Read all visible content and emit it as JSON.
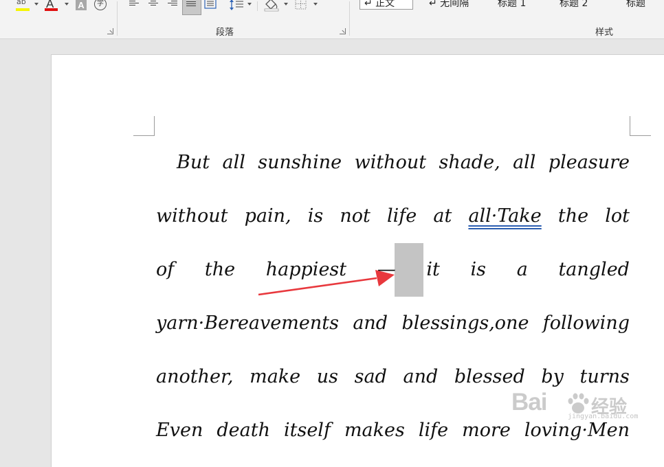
{
  "ribbon": {
    "font_group": {
      "highlight_glyph": "ab",
      "font_color_glyph": "A",
      "char_shading_glyph": "A",
      "enclose_char_glyph": "字"
    },
    "paragraph_group": {
      "label": "段落"
    },
    "styles_group": {
      "label": "样式",
      "items": [
        {
          "label": "↵ 正文",
          "selected": true
        },
        {
          "label": "↵ 无间隔",
          "selected": false
        },
        {
          "label": "标题 1",
          "selected": false
        },
        {
          "label": "标题 2",
          "selected": false
        },
        {
          "label": "标题",
          "selected": false
        }
      ]
    },
    "colors": {
      "highlight": "#f5f500",
      "font_color": "#e01010"
    }
  },
  "document": {
    "lines": [
      [
        "But",
        "all",
        "sunshine",
        "without",
        "shade,",
        "all",
        "pleasure"
      ],
      [
        "without",
        "pain,",
        "is",
        "not",
        "life",
        "at",
        "all·Take",
        "the",
        "lot"
      ],
      [
        "of",
        "the",
        "happiest",
        "—",
        "it",
        "is",
        "a",
        "tangled"
      ],
      [
        "yarn·Bereavements",
        "and",
        "blessings,one",
        "following"
      ],
      [
        "another,",
        "make",
        "us",
        "sad",
        "and",
        "blessed",
        "by",
        "turns"
      ],
      [
        "Even",
        "death",
        "itself",
        "makes",
        "life",
        "more",
        "loving·Men"
      ]
    ]
  },
  "watermark": {
    "brand": "Bai",
    "brand_tail": "经验",
    "sub": "jingyan.baidu.com"
  },
  "annotation": {
    "arrow_color": "#e8383d"
  }
}
